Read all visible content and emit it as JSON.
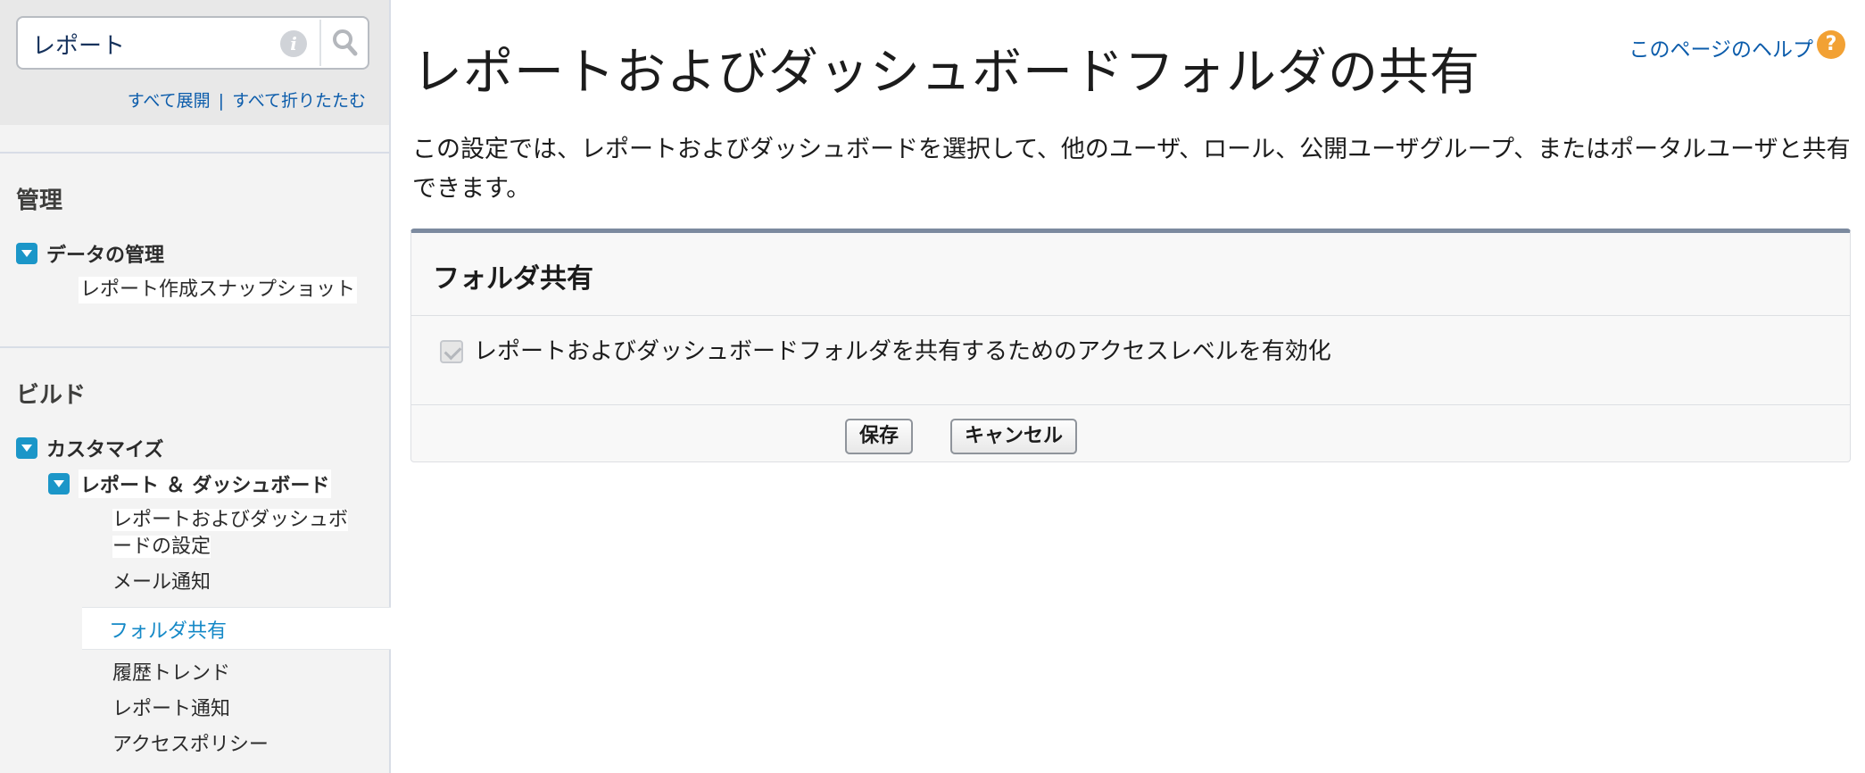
{
  "sidebar": {
    "search": {
      "value": "レポート"
    },
    "expand_all": "すべて展開",
    "separator": "|",
    "collapse_all": "すべて折りたたむ",
    "sections": [
      {
        "heading": "管理",
        "groups": [
          {
            "label": "データの管理",
            "items": [
              "レポート作成スナップショット"
            ]
          }
        ]
      },
      {
        "heading": "ビルド",
        "groups": [
          {
            "label": "カスタマイズ",
            "subgroups": [
              {
                "label": "レポート ＆ ダッシュボード",
                "items": [
                  {
                    "label_line1": "レポートおよびダッシュボ",
                    "label_line2": "ードの設定"
                  },
                  {
                    "label": "メール通知"
                  },
                  {
                    "label": "フォルダ共有",
                    "selected": true
                  },
                  {
                    "label": "履歴トレンド"
                  },
                  {
                    "label": "レポート通知"
                  },
                  {
                    "label": "アクセスポリシー"
                  }
                ]
              }
            ]
          }
        ]
      }
    ]
  },
  "main": {
    "title": "レポートおよびダッシュボードフォルダの共有",
    "help_link": "このページのヘルプ",
    "help_icon": "?",
    "description": "この設定では、レポートおよびダッシュボードを選択して、他のユーザ、ロール、公開ユーザグループ、またはポータルユーザと共有できます。",
    "panel": {
      "title": "フォルダ共有",
      "checkbox_label": "レポートおよびダッシュボードフォルダを共有するためのアクセスレベルを有効化",
      "checkbox_checked": true,
      "save_button": "保存",
      "cancel_button": "キャンセル"
    }
  },
  "colors": {
    "link": "#0b5cab",
    "selected_link": "#1589c7",
    "toggle": "#1b96c8",
    "help_icon": "#f2a134",
    "panel_top_border": "#7c8a9f"
  },
  "icons": {
    "search": "search-icon",
    "info": "info-icon",
    "help": "help-icon",
    "tree_toggle": "chevron-down-icon",
    "checkbox": "checkbox-checked-icon"
  }
}
